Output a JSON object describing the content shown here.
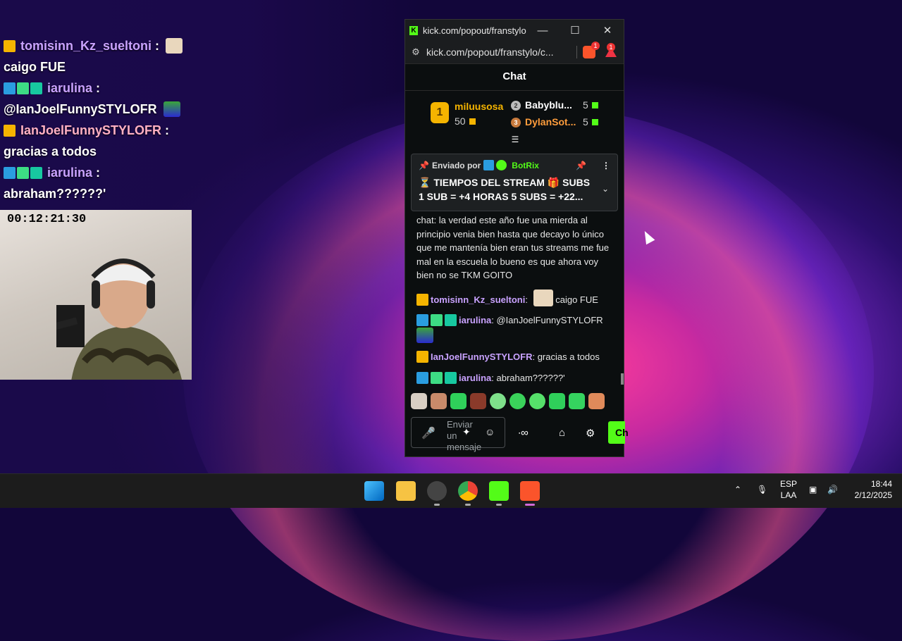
{
  "overlay": {
    "lines": [
      {
        "user": "tomisinn_Kz_sueltoni",
        "sep": " :"
      },
      {
        "text": "caigo FUE"
      },
      {
        "user": "iarulina",
        "sep": " :"
      },
      {
        "text": "@IanJoelFunnySTYLOFR"
      },
      {
        "user": "IanJoelFunnySTYLOFR",
        "sep": " :"
      },
      {
        "text": "gracias a todos"
      },
      {
        "user": "iarulina",
        "sep": " :"
      },
      {
        "text": "abraham??????'"
      }
    ],
    "timer": "00:12:21:30"
  },
  "window": {
    "title": "kick.com/popout/franstylo...",
    "url": "kick.com/popout/franstylo/c...",
    "brave_badge": "1",
    "alert_badge": "1",
    "minimize": "—",
    "maximize": "☐",
    "close": "✕"
  },
  "chat": {
    "header": "Chat",
    "leaderboard": {
      "first": {
        "rank": "1",
        "name": "miluusosa",
        "value": "50"
      },
      "second": {
        "rank": "2",
        "name": "Babyblu...",
        "value": "5"
      },
      "third": {
        "rank": "3",
        "name": "DylanSot...",
        "value": "5"
      }
    },
    "pinned": {
      "by_label": "Enviado por",
      "by_user": "BotRix",
      "text": "⏳ TIEMPOS DEL STREAM 🎁 SUBS 1 SUB = +4 HORAS 5 SUBS = +22..."
    },
    "messages": [
      {
        "user": "",
        "text": "chat: la verdad este año fue una mierda al principio venia bien hasta que decayo lo único que me mantenía bien eran tus streams me fue mal en la escuela lo bueno es que ahora voy bien no se TKM GOITO"
      },
      {
        "user": "tomisinn_Kz_sueltoni",
        "text": "caigo FUE"
      },
      {
        "user": "iarulina",
        "text": "@IanJoelFunnySTYLOFR"
      },
      {
        "user": "IanJoelFunnySTYLOFR",
        "text": "gracias a todos"
      },
      {
        "user": "iarulina",
        "text": "abraham??????'"
      }
    ],
    "input_placeholder": "Enviar un mensaje",
    "send_label": "Ch"
  },
  "taskbar": {
    "lang": "ESP",
    "layout": "LAA",
    "time": "18:44",
    "date": "2/12/2025"
  },
  "colors": {
    "kick_green": "#53fc18",
    "gold": "#f5b400",
    "username": "#c9a2ff"
  }
}
